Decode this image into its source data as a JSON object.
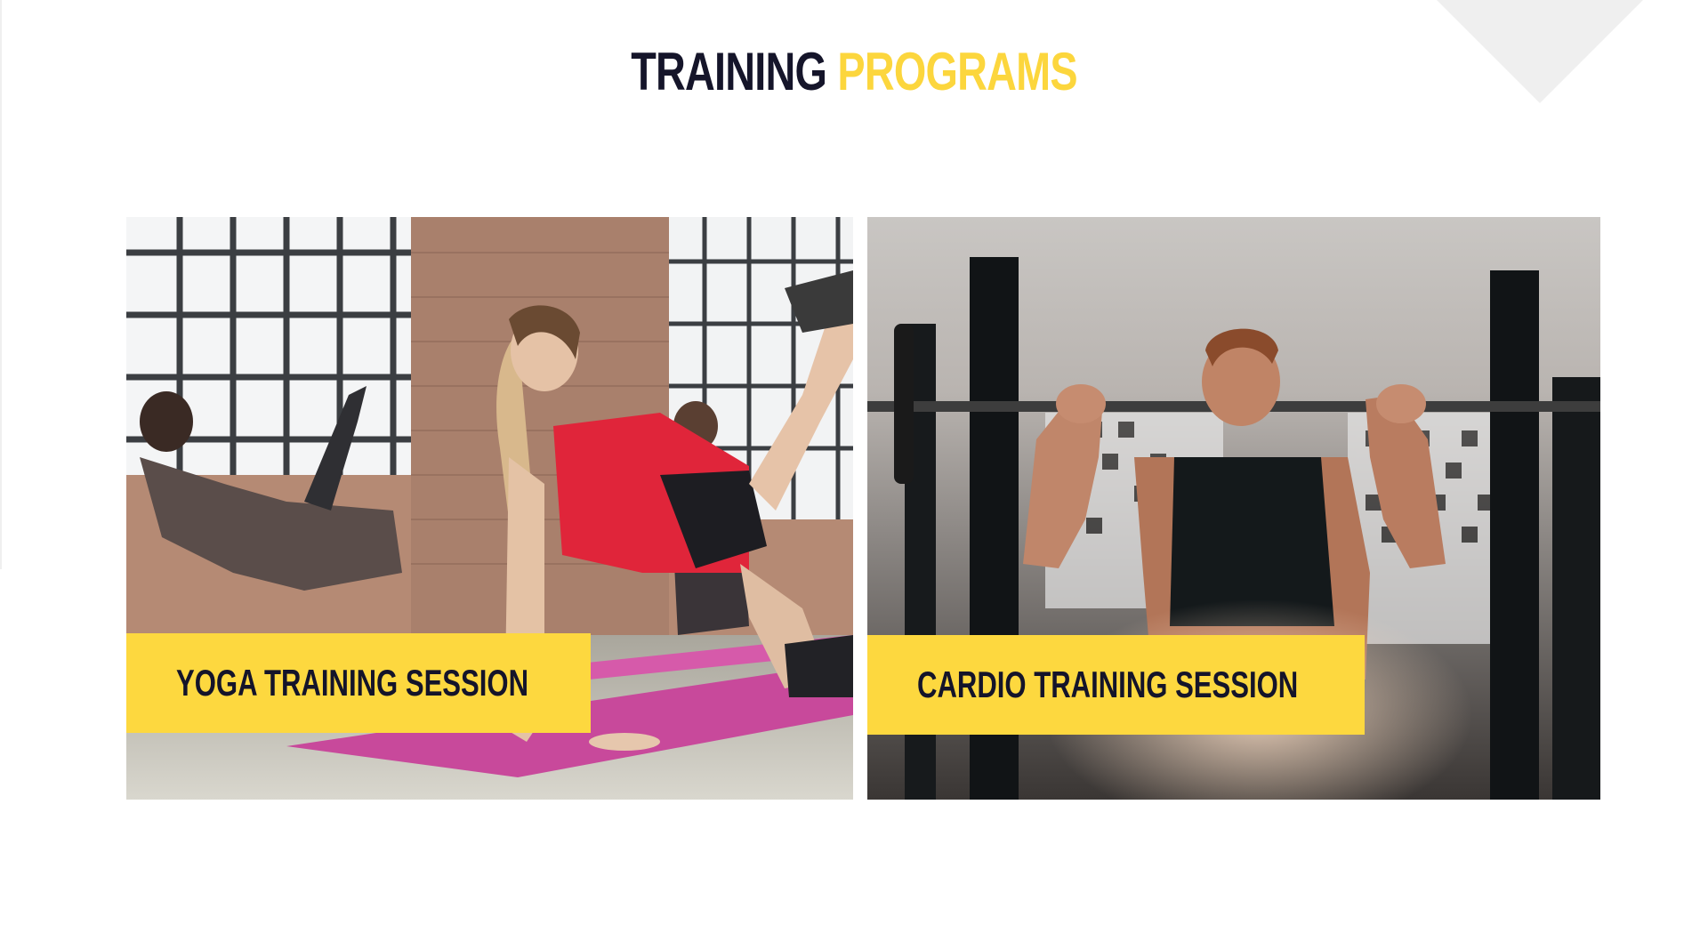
{
  "section": {
    "title_part_1": "TRAINING",
    "title_part_2": "PROGRAMS"
  },
  "colors": {
    "accent_yellow": "#fdd83f",
    "title_dark": "#15152a",
    "background": "#ffffff"
  },
  "programs": [
    {
      "label": "YOGA TRAINING SESSION",
      "icon": "arrow-right-icon"
    },
    {
      "label": "CARDIO TRAINING SESSION",
      "icon": "arrow-right-icon"
    }
  ]
}
